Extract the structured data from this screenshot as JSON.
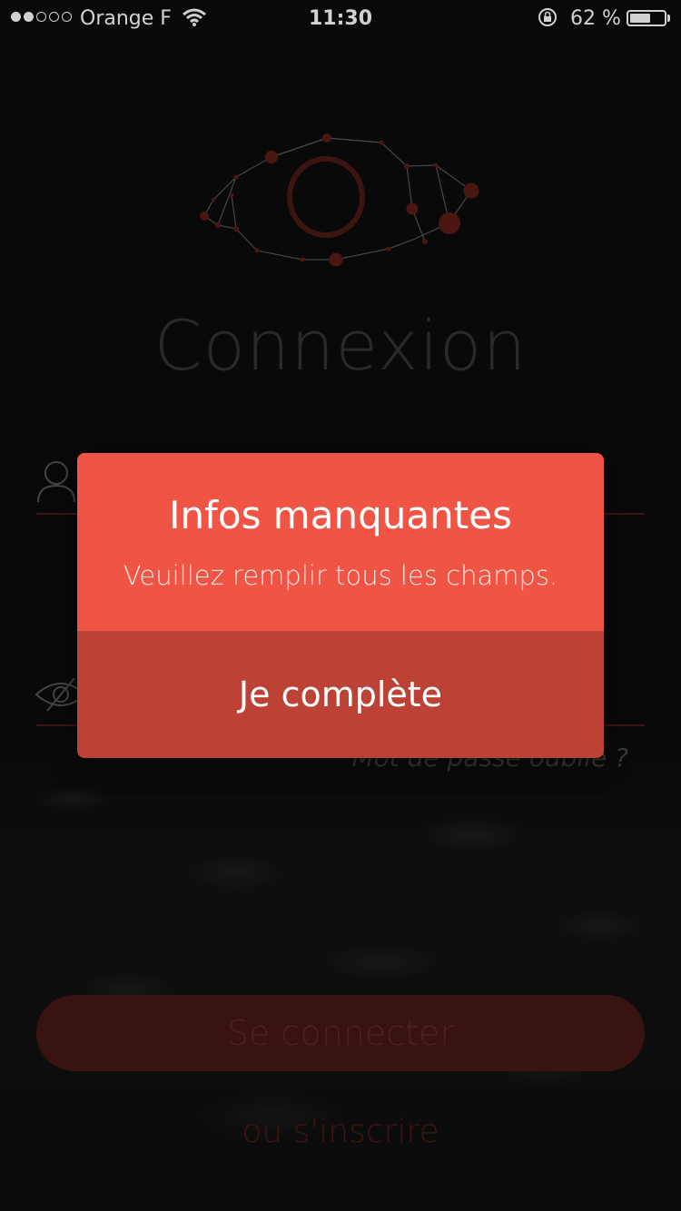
{
  "status_bar": {
    "carrier": "Orange F",
    "time": "11:30",
    "battery_percent": "62 %",
    "battery_level": 0.62,
    "signal_bars_filled": 2,
    "signal_bars_total": 5
  },
  "login": {
    "title": "Connexion",
    "forgot_password": "Mot de passe oublié ?",
    "connect_button": "Se connecter",
    "signup_link": "ou s'inscrire"
  },
  "alert": {
    "title": "Infos manquantes",
    "message": "Veuillez remplir tous les champs.",
    "button": "Je complète"
  },
  "colors": {
    "alert_top": "#f05445",
    "alert_button": "#bc4235",
    "accent_dark_red": "#451815"
  },
  "icons": {
    "logo": "eye-constellation-logo",
    "username": "user-icon",
    "password": "eye-slash-icon",
    "wifi": "wifi-icon",
    "rotation_lock": "rotation-lock-icon",
    "battery": "battery-icon"
  }
}
